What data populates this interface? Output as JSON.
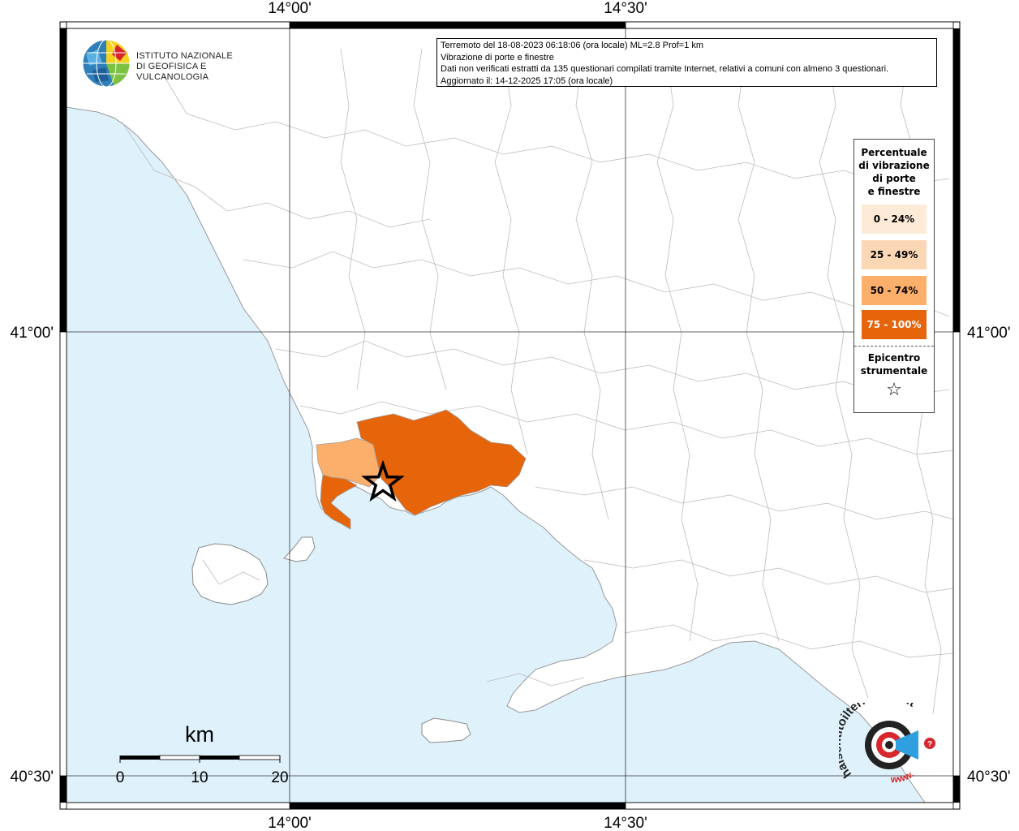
{
  "map": {
    "lon_labels": [
      "14°00'",
      "14°30'"
    ],
    "lat_labels": [
      "41°00'",
      "40°30'"
    ],
    "colors": {
      "sea": "#dff1fb",
      "land": "#ffffff",
      "border": "#b8b8b8",
      "class_0_24": "#fdebd7",
      "class_25_49": "#fcd7b5",
      "class_50_74": "#fcae6b",
      "class_75_100": "#e6640a"
    }
  },
  "info": {
    "line1": "Terremoto del 18-08-2023 06:18:06 (ora locale) ML=2.8 Prof=1 km",
    "line2": "Vibrazione di porte e finestre",
    "line3": "Dati non verificati estratti da 135 questionari compilati tramite Internet, relativi a comuni con almeno 3 questionari.",
    "line4": "Aggiornato il: 14-12-2025 17:05 (ora locale)"
  },
  "legend": {
    "title_lines": [
      "Percentuale",
      "di vibrazione",
      "di porte",
      "e finestre"
    ],
    "classes": [
      {
        "label": "0 - 24%",
        "color": "#fdebd7",
        "text_color": "#000000"
      },
      {
        "label": "25 - 49%",
        "color": "#fcd7b5",
        "text_color": "#000000"
      },
      {
        "label": "50 - 74%",
        "color": "#fcae6b",
        "text_color": "#000000"
      },
      {
        "label": "75 - 100%",
        "color": "#e6640a",
        "text_color": "#ffffff"
      }
    ],
    "epicenter_lines": [
      "Epicentro",
      "strumentale"
    ],
    "epicenter_icon": "star-outline-icon"
  },
  "scalebar": {
    "unit": "km",
    "ticks": [
      "0",
      "10",
      "20"
    ]
  },
  "logos": {
    "ingv_line1": "ISTITUTO NAZIONALE",
    "ingv_line2": "DI GEOFISICA E VULCANOLOGIA",
    "hst_text": "haisentitoilterremoto.it",
    "hst_www": "www."
  }
}
